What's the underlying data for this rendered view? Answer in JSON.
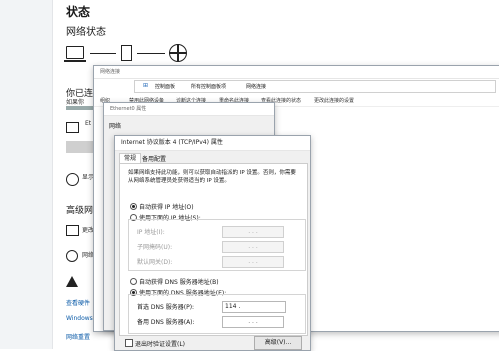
{
  "settings": {
    "title": "状态",
    "subtitle": "网络状态",
    "section_partial": "你已连接",
    "desc_partial": "如果你",
    "ethernet_partial": "Et",
    "show_partial": "显示",
    "advanced_partial": "高级网",
    "change_partial": "更改",
    "network_partial": "网络",
    "links": [
      "查看硬件",
      "Windows",
      "网络重置"
    ]
  },
  "netconn": {
    "title": "网络连接",
    "breadcrumb": [
      "控制面板",
      "所有控制面板项",
      "网络连接"
    ],
    "organize": "组织",
    "toolbar": [
      "禁用此网络设备",
      "诊断这个连接",
      "重命名此连接",
      "查看此连接的状态",
      "更改此连接的设置"
    ]
  },
  "eth_props": {
    "title": "Ethernet0 属性",
    "tab": "网络"
  },
  "ipv4": {
    "title": "Internet 协议版本 4 (TCP/IPv4) 属性",
    "tabs": [
      "常规",
      "备用配置"
    ],
    "description": "如果网络支持此功能，则可以获取自动指派的 IP 设置。否则，你需要从网络系统管理员处获得适当的 IP 设置。",
    "auto_ip": "自动获得 IP 地址(O)",
    "manual_ip": "使用下面的 IP 地址(S):",
    "ip_label": "IP 地址(I):",
    "mask_label": "子网掩码(U):",
    "gateway_label": "默认网关(D):",
    "auto_dns": "自动获得 DNS 服务器地址(B)",
    "manual_dns": "使用下面的 DNS 服务器地址(E):",
    "preferred_dns_label": "首选 DNS 服务器(P):",
    "alternate_dns_label": "备用 DNS 服务器(A):",
    "preferred_dns_value": "114 .",
    "dots": ".        .        .",
    "validate_label": "退出时验证设置(L)",
    "advanced_button": "高级(V)..."
  }
}
